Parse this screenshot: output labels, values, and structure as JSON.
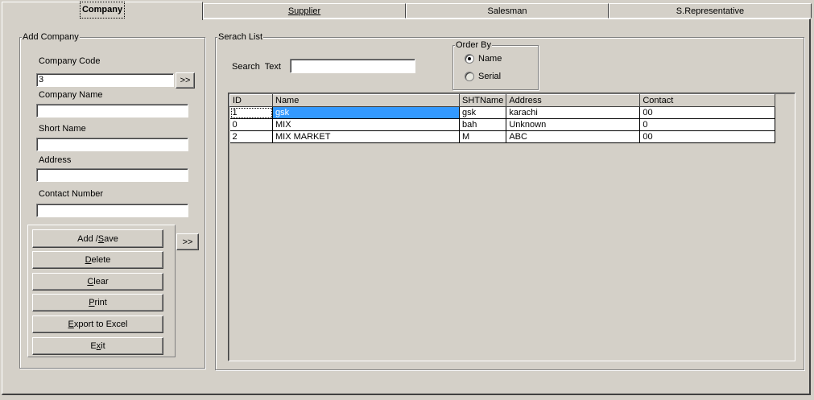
{
  "tabs": [
    {
      "label": "Company",
      "active": true
    },
    {
      "label": "Supplier",
      "active": false
    },
    {
      "label": "Salesman",
      "active": false
    },
    {
      "label": "S.Representative",
      "active": false
    }
  ],
  "add_company": {
    "title": "Add Company",
    "company_code_label": "Company Code",
    "company_code_value": "3",
    "company_name_label": "Company Name",
    "company_name_value": "",
    "short_name_label": "Short Name",
    "short_name_value": "",
    "address_label": "Address",
    "address_value": "",
    "contact_label": "Contact Number",
    "contact_value": "",
    "code_next_label": ">>",
    "side_next_label": ">>"
  },
  "buttons": [
    {
      "pre": "Add / ",
      "ul": "S",
      "post": "ave"
    },
    {
      "pre": "",
      "ul": "D",
      "post": "elete"
    },
    {
      "pre": "",
      "ul": "C",
      "post": "lear"
    },
    {
      "pre": "",
      "ul": "P",
      "post": "rint"
    },
    {
      "pre": "",
      "ul": "E",
      "post": "xport to Excel"
    },
    {
      "pre": "E",
      "ul": "x",
      "post": "it"
    }
  ],
  "search": {
    "title": "Serach List",
    "search_text_label": "Search  Text",
    "search_text_value": "",
    "order_by": {
      "title": "Order By",
      "options": [
        {
          "label": "Name",
          "checked": true
        },
        {
          "label": "Serial",
          "checked": false
        }
      ]
    }
  },
  "grid": {
    "columns": [
      "ID",
      "Name",
      "SHTName",
      "Address",
      "Contact"
    ],
    "rows": [
      [
        "1",
        "gsk",
        "gsk",
        "karachi",
        "00"
      ],
      [
        "0",
        "MIX",
        "bah",
        "Unknown",
        "0"
      ],
      [
        "2",
        "MIX MARKET",
        "M",
        "ABC",
        "00"
      ]
    ]
  }
}
